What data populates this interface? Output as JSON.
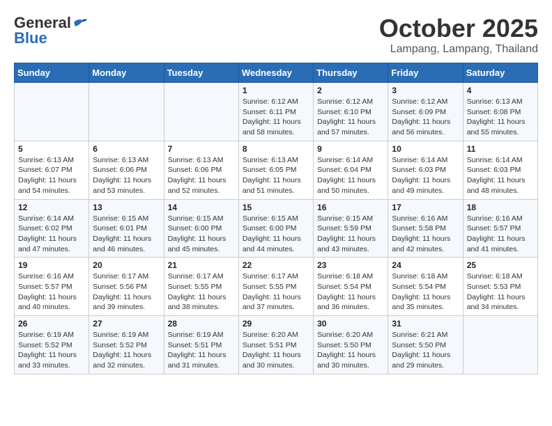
{
  "header": {
    "logo_general": "General",
    "logo_blue": "Blue",
    "month": "October 2025",
    "location": "Lampang, Lampang, Thailand"
  },
  "weekdays": [
    "Sunday",
    "Monday",
    "Tuesday",
    "Wednesday",
    "Thursday",
    "Friday",
    "Saturday"
  ],
  "weeks": [
    [
      {
        "day": "",
        "sunrise": "",
        "sunset": "",
        "daylight": ""
      },
      {
        "day": "",
        "sunrise": "",
        "sunset": "",
        "daylight": ""
      },
      {
        "day": "",
        "sunrise": "",
        "sunset": "",
        "daylight": ""
      },
      {
        "day": "1",
        "sunrise": "Sunrise: 6:12 AM",
        "sunset": "Sunset: 6:11 PM",
        "daylight": "Daylight: 11 hours and 58 minutes."
      },
      {
        "day": "2",
        "sunrise": "Sunrise: 6:12 AM",
        "sunset": "Sunset: 6:10 PM",
        "daylight": "Daylight: 11 hours and 57 minutes."
      },
      {
        "day": "3",
        "sunrise": "Sunrise: 6:12 AM",
        "sunset": "Sunset: 6:09 PM",
        "daylight": "Daylight: 11 hours and 56 minutes."
      },
      {
        "day": "4",
        "sunrise": "Sunrise: 6:13 AM",
        "sunset": "Sunset: 6:08 PM",
        "daylight": "Daylight: 11 hours and 55 minutes."
      }
    ],
    [
      {
        "day": "5",
        "sunrise": "Sunrise: 6:13 AM",
        "sunset": "Sunset: 6:07 PM",
        "daylight": "Daylight: 11 hours and 54 minutes."
      },
      {
        "day": "6",
        "sunrise": "Sunrise: 6:13 AM",
        "sunset": "Sunset: 6:06 PM",
        "daylight": "Daylight: 11 hours and 53 minutes."
      },
      {
        "day": "7",
        "sunrise": "Sunrise: 6:13 AM",
        "sunset": "Sunset: 6:06 PM",
        "daylight": "Daylight: 11 hours and 52 minutes."
      },
      {
        "day": "8",
        "sunrise": "Sunrise: 6:13 AM",
        "sunset": "Sunset: 6:05 PM",
        "daylight": "Daylight: 11 hours and 51 minutes."
      },
      {
        "day": "9",
        "sunrise": "Sunrise: 6:14 AM",
        "sunset": "Sunset: 6:04 PM",
        "daylight": "Daylight: 11 hours and 50 minutes."
      },
      {
        "day": "10",
        "sunrise": "Sunrise: 6:14 AM",
        "sunset": "Sunset: 6:03 PM",
        "daylight": "Daylight: 11 hours and 49 minutes."
      },
      {
        "day": "11",
        "sunrise": "Sunrise: 6:14 AM",
        "sunset": "Sunset: 6:03 PM",
        "daylight": "Daylight: 11 hours and 48 minutes."
      }
    ],
    [
      {
        "day": "12",
        "sunrise": "Sunrise: 6:14 AM",
        "sunset": "Sunset: 6:02 PM",
        "daylight": "Daylight: 11 hours and 47 minutes."
      },
      {
        "day": "13",
        "sunrise": "Sunrise: 6:15 AM",
        "sunset": "Sunset: 6:01 PM",
        "daylight": "Daylight: 11 hours and 46 minutes."
      },
      {
        "day": "14",
        "sunrise": "Sunrise: 6:15 AM",
        "sunset": "Sunset: 6:00 PM",
        "daylight": "Daylight: 11 hours and 45 minutes."
      },
      {
        "day": "15",
        "sunrise": "Sunrise: 6:15 AM",
        "sunset": "Sunset: 6:00 PM",
        "daylight": "Daylight: 11 hours and 44 minutes."
      },
      {
        "day": "16",
        "sunrise": "Sunrise: 6:15 AM",
        "sunset": "Sunset: 5:59 PM",
        "daylight": "Daylight: 11 hours and 43 minutes."
      },
      {
        "day": "17",
        "sunrise": "Sunrise: 6:16 AM",
        "sunset": "Sunset: 5:58 PM",
        "daylight": "Daylight: 11 hours and 42 minutes."
      },
      {
        "day": "18",
        "sunrise": "Sunrise: 6:16 AM",
        "sunset": "Sunset: 5:57 PM",
        "daylight": "Daylight: 11 hours and 41 minutes."
      }
    ],
    [
      {
        "day": "19",
        "sunrise": "Sunrise: 6:16 AM",
        "sunset": "Sunset: 5:57 PM",
        "daylight": "Daylight: 11 hours and 40 minutes."
      },
      {
        "day": "20",
        "sunrise": "Sunrise: 6:17 AM",
        "sunset": "Sunset: 5:56 PM",
        "daylight": "Daylight: 11 hours and 39 minutes."
      },
      {
        "day": "21",
        "sunrise": "Sunrise: 6:17 AM",
        "sunset": "Sunset: 5:55 PM",
        "daylight": "Daylight: 11 hours and 38 minutes."
      },
      {
        "day": "22",
        "sunrise": "Sunrise: 6:17 AM",
        "sunset": "Sunset: 5:55 PM",
        "daylight": "Daylight: 11 hours and 37 minutes."
      },
      {
        "day": "23",
        "sunrise": "Sunrise: 6:18 AM",
        "sunset": "Sunset: 5:54 PM",
        "daylight": "Daylight: 11 hours and 36 minutes."
      },
      {
        "day": "24",
        "sunrise": "Sunrise: 6:18 AM",
        "sunset": "Sunset: 5:54 PM",
        "daylight": "Daylight: 11 hours and 35 minutes."
      },
      {
        "day": "25",
        "sunrise": "Sunrise: 6:18 AM",
        "sunset": "Sunset: 5:53 PM",
        "daylight": "Daylight: 11 hours and 34 minutes."
      }
    ],
    [
      {
        "day": "26",
        "sunrise": "Sunrise: 6:19 AM",
        "sunset": "Sunset: 5:52 PM",
        "daylight": "Daylight: 11 hours and 33 minutes."
      },
      {
        "day": "27",
        "sunrise": "Sunrise: 6:19 AM",
        "sunset": "Sunset: 5:52 PM",
        "daylight": "Daylight: 11 hours and 32 minutes."
      },
      {
        "day": "28",
        "sunrise": "Sunrise: 6:19 AM",
        "sunset": "Sunset: 5:51 PM",
        "daylight": "Daylight: 11 hours and 31 minutes."
      },
      {
        "day": "29",
        "sunrise": "Sunrise: 6:20 AM",
        "sunset": "Sunset: 5:51 PM",
        "daylight": "Daylight: 11 hours and 30 minutes."
      },
      {
        "day": "30",
        "sunrise": "Sunrise: 6:20 AM",
        "sunset": "Sunset: 5:50 PM",
        "daylight": "Daylight: 11 hours and 30 minutes."
      },
      {
        "day": "31",
        "sunrise": "Sunrise: 6:21 AM",
        "sunset": "Sunset: 5:50 PM",
        "daylight": "Daylight: 11 hours and 29 minutes."
      },
      {
        "day": "",
        "sunrise": "",
        "sunset": "",
        "daylight": ""
      }
    ]
  ]
}
